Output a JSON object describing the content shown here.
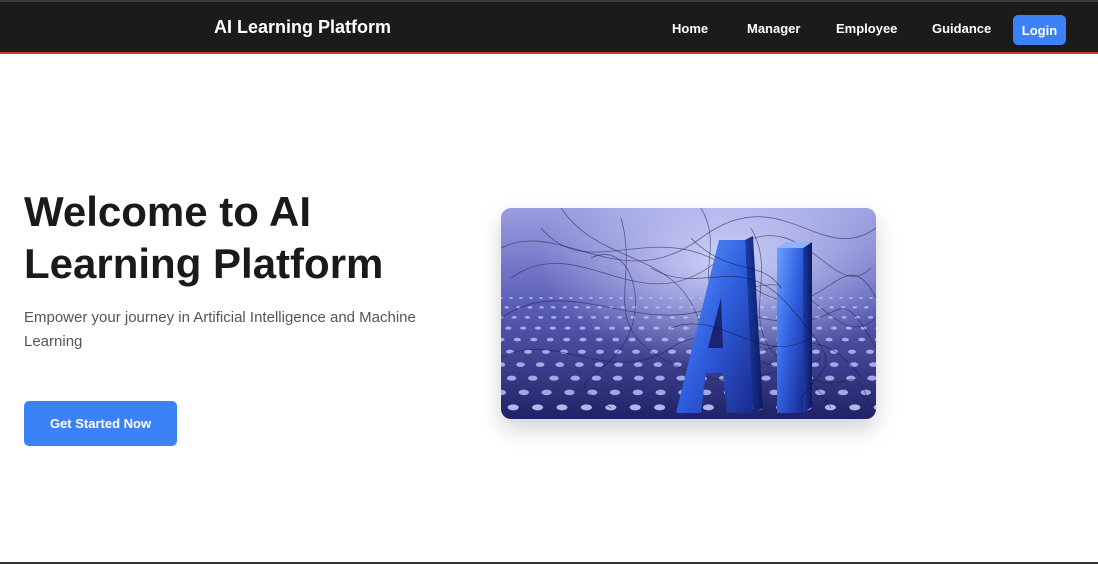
{
  "navbar": {
    "brand": "AI Learning Platform",
    "links": [
      "Home",
      "Manager",
      "Employee",
      "Guidance"
    ],
    "login_label": "Login"
  },
  "hero": {
    "title": "Welcome to AI Learning Platform",
    "subtitle": "Empower your journey in Artificial Intelligence and Machine Learning",
    "cta_label": "Get Started Now",
    "image_text": "AI"
  },
  "colors": {
    "navbar_bg": "#1b1b1b",
    "accent": "#3b82f6",
    "title_text": "#1a1a1a",
    "subtitle_text": "#555555"
  }
}
